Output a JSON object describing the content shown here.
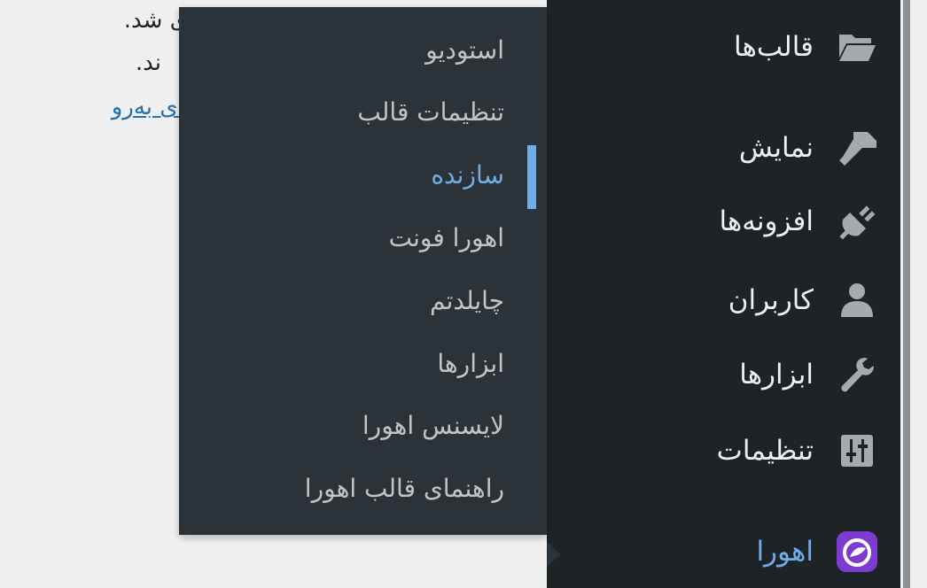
{
  "background": {
    "line1": "ی شد.",
    "line2": "ند.",
    "link": "به صفحه‌ی به‌رو"
  },
  "sidebar": {
    "items": [
      {
        "label": "قالب‌ها",
        "icon": "folder-open-icon"
      },
      {
        "label": "نمایش",
        "icon": "paintbrush-icon"
      },
      {
        "label": "افزونه‌ها",
        "icon": "plugin-icon"
      },
      {
        "label": "کاربران",
        "icon": "user-icon"
      },
      {
        "label": "ابزارها",
        "icon": "wrench-icon"
      },
      {
        "label": "تنظیمات",
        "icon": "settings-sliders-icon"
      },
      {
        "label": "اهورا",
        "icon": "ahura-logo-icon",
        "current": true
      }
    ]
  },
  "flyout": {
    "items": [
      {
        "label": "استودیو"
      },
      {
        "label": "تنظیمات قالب"
      },
      {
        "label": "سازنده",
        "active": true
      },
      {
        "label": "اهورا فونت"
      },
      {
        "label": "چایلدتم"
      },
      {
        "label": "ابزارها"
      },
      {
        "label": "لایسنس اهورا"
      },
      {
        "label": "راهنمای قالب اهورا"
      }
    ]
  },
  "colors": {
    "sidebar_bg": "#1d2327",
    "flyout_bg": "#2c3338",
    "accent": "#72aee6",
    "text": "#f0f0f1",
    "sub_text": "#c3c4c7",
    "link": "#2271b1",
    "logo_purple": "#7e3bd0"
  }
}
